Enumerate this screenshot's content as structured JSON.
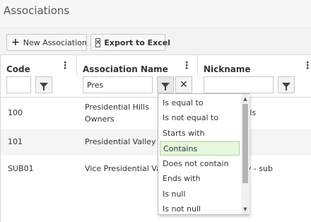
{
  "header": {
    "title": "Associations"
  },
  "toolbar": {
    "new_label": "New Association",
    "export_label": "Export to Excel"
  },
  "grid": {
    "columns": [
      {
        "label": "Code"
      },
      {
        "label": "Association Name"
      },
      {
        "label": "Nickname"
      }
    ],
    "filters": {
      "code_value": "",
      "name_value": "Pres",
      "nickname_value": ""
    },
    "rows": [
      {
        "code": "100",
        "name": "Presidential Hills Owners Association, Inc",
        "nickname": "Hills"
      },
      {
        "code": "101",
        "name": "Presidential Valley",
        "nickname": ""
      },
      {
        "code": "SUB01",
        "name": "Vice Presidential Valley",
        "nickname": "ley - sub"
      }
    ]
  },
  "filter_menu": {
    "selected": "Contains",
    "options": [
      "Is equal to",
      "Is not equal to",
      "Starts with",
      "Contains",
      "Does not contain",
      "Ends with",
      "Is null",
      "Is not null"
    ]
  }
}
